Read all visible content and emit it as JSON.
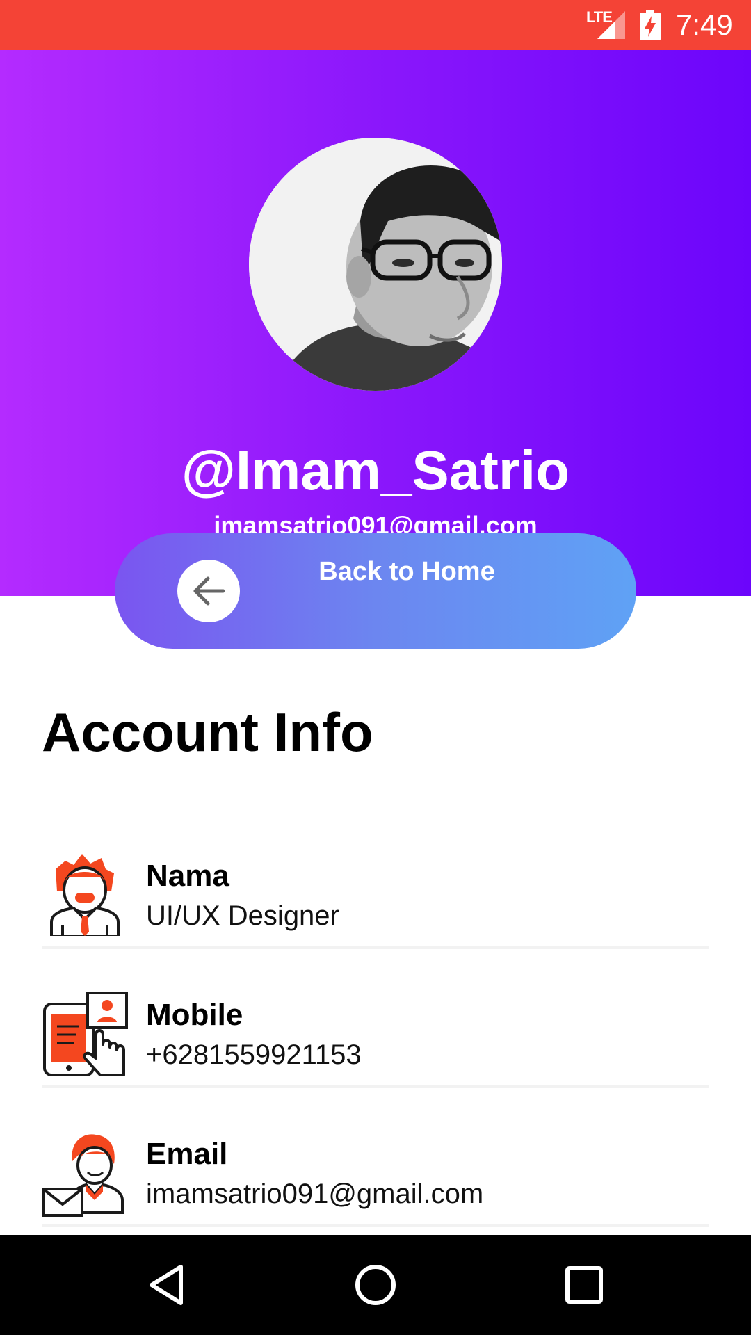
{
  "status_bar": {
    "network": "LTE",
    "time": "7:49"
  },
  "profile": {
    "username": "@Imam_Satrio",
    "email": "imamsatrio091@gmail.com"
  },
  "back_button": {
    "label": "Back to Home"
  },
  "account_info": {
    "title": "Account Info",
    "items": [
      {
        "label": "Nama",
        "value": "UI/UX Designer",
        "icon": "designer-person-icon"
      },
      {
        "label": "Mobile",
        "value": "+6281559921153",
        "icon": "mobile-touch-icon"
      },
      {
        "label": "Email",
        "value": "imamsatrio091@gmail.com",
        "icon": "email-person-icon"
      }
    ]
  },
  "colors": {
    "status_bar": "#F44336",
    "hero_gradient_start": "#B42BFF",
    "hero_gradient_end": "#6C05FB",
    "button_gradient_start": "#7A55F0",
    "button_gradient_end": "#5FA2F5",
    "icon_accent": "#F4471F"
  },
  "nav": {
    "back": "back-icon",
    "home": "home-icon",
    "recents": "recents-icon"
  }
}
